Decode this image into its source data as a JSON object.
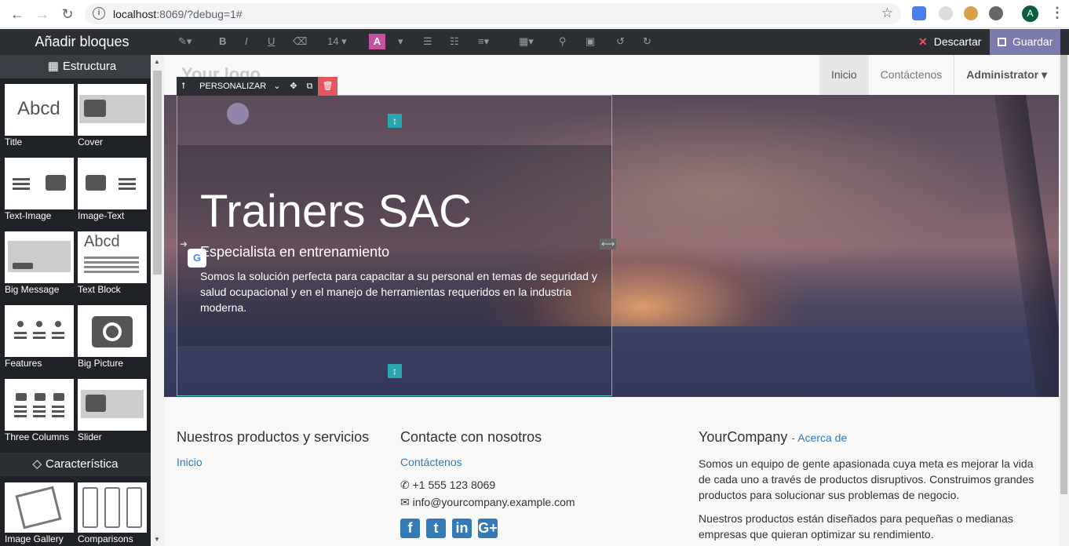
{
  "browser": {
    "url_host": "localhost",
    "url_rest": ":8069/?debug=1#",
    "avatar_letter": "A"
  },
  "sidebar": {
    "title": "Añadir bloques",
    "section_structure": "Estructura",
    "blocks": [
      {
        "label": "Title",
        "preview": "Abcd"
      },
      {
        "label": "Cover"
      },
      {
        "label": "Text-Image"
      },
      {
        "label": "Image-Text"
      },
      {
        "label": "Big Message"
      },
      {
        "label": "Text Block",
        "preview": "Abcd"
      },
      {
        "label": "Features"
      },
      {
        "label": "Big Picture"
      },
      {
        "label": "Three Columns"
      },
      {
        "label": "Slider"
      }
    ],
    "section_feature": "Característica",
    "blocks2": [
      {
        "label": "Image Gallery"
      },
      {
        "label": "Comparisons"
      }
    ]
  },
  "toolbar": {
    "font_size": "14",
    "color_letter": "A",
    "discard_label": "Descartar",
    "save_label": "Guardar",
    "accent_color": "#7c7bad"
  },
  "header": {
    "logo_text": "Your logo",
    "menu": [
      "Inicio",
      "Contáctenos",
      "Administrator"
    ]
  },
  "snippet_controls": {
    "customize_label": "PERSONALIZAR"
  },
  "hero": {
    "title": "Trainers SAC",
    "subtitle": "Especialista en entrenamiento",
    "text": "Somos la solución perfecta para capacitar a su personal en temas de seguridad y salud ocupacional y en el manejo de herramientas requeridos en la industria moderna."
  },
  "footer": {
    "col1": {
      "title": "Nuestros productos y servicios",
      "link": "Inicio"
    },
    "col2": {
      "title": "Contacte con nosotros",
      "link": "Contáctenos",
      "phone": "+1 555 123 8069",
      "email": "info@yourcompany.example.com"
    },
    "col3": {
      "title": "YourCompany",
      "about": "- Acerca de",
      "p1": "Somos un equipo de gente apasionada cuya meta es mejorar la vida de cada uno a través de productos disruptivos. Construimos grandes productos para solucionar sus problemas de negocio.",
      "p2": "Nuestros productos están diseñados para pequeñas o medianas empresas que quieran optimizar su rendimiento."
    }
  }
}
